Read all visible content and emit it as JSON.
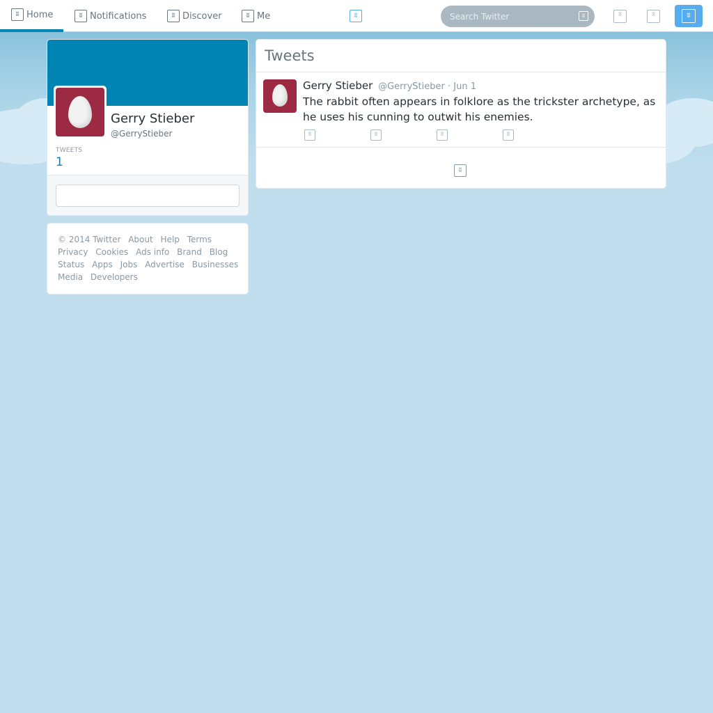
{
  "nav": {
    "items": [
      {
        "label": "Home",
        "icon": "home-icon"
      },
      {
        "label": "Notifications",
        "icon": "notifications-icon"
      },
      {
        "label": "Discover",
        "icon": "discover-icon"
      },
      {
        "label": "Me",
        "icon": "me-icon"
      }
    ],
    "active": "Home"
  },
  "search": {
    "placeholder": "Search Twitter"
  },
  "profile": {
    "name": "Gerry Stieber",
    "handle": "@GerryStieber",
    "tweets_label": "TWEETS",
    "tweets_count": "1"
  },
  "footer": {
    "lines": [
      [
        "© 2014 Twitter",
        "About",
        "Help",
        "Terms"
      ],
      [
        "Privacy",
        "Cookies",
        "Ads info",
        "Brand",
        "Blog"
      ],
      [
        "Status",
        "Apps",
        "Jobs",
        "Advertise",
        "Businesses"
      ],
      [
        "Media",
        "Developers"
      ]
    ]
  },
  "timeline": {
    "title": "Tweets",
    "tweets": [
      {
        "name": "Gerry Stieber",
        "meta": "@GerryStieber · Jun 1",
        "text": "The rabbit often appears in folklore as the trickster archetype, as he uses his cunning to outwit his enemies."
      }
    ]
  },
  "colors": {
    "accent": "#0084b4",
    "background": "#c0deed",
    "avatar": "#9c2a43",
    "compose": "#55acee"
  }
}
